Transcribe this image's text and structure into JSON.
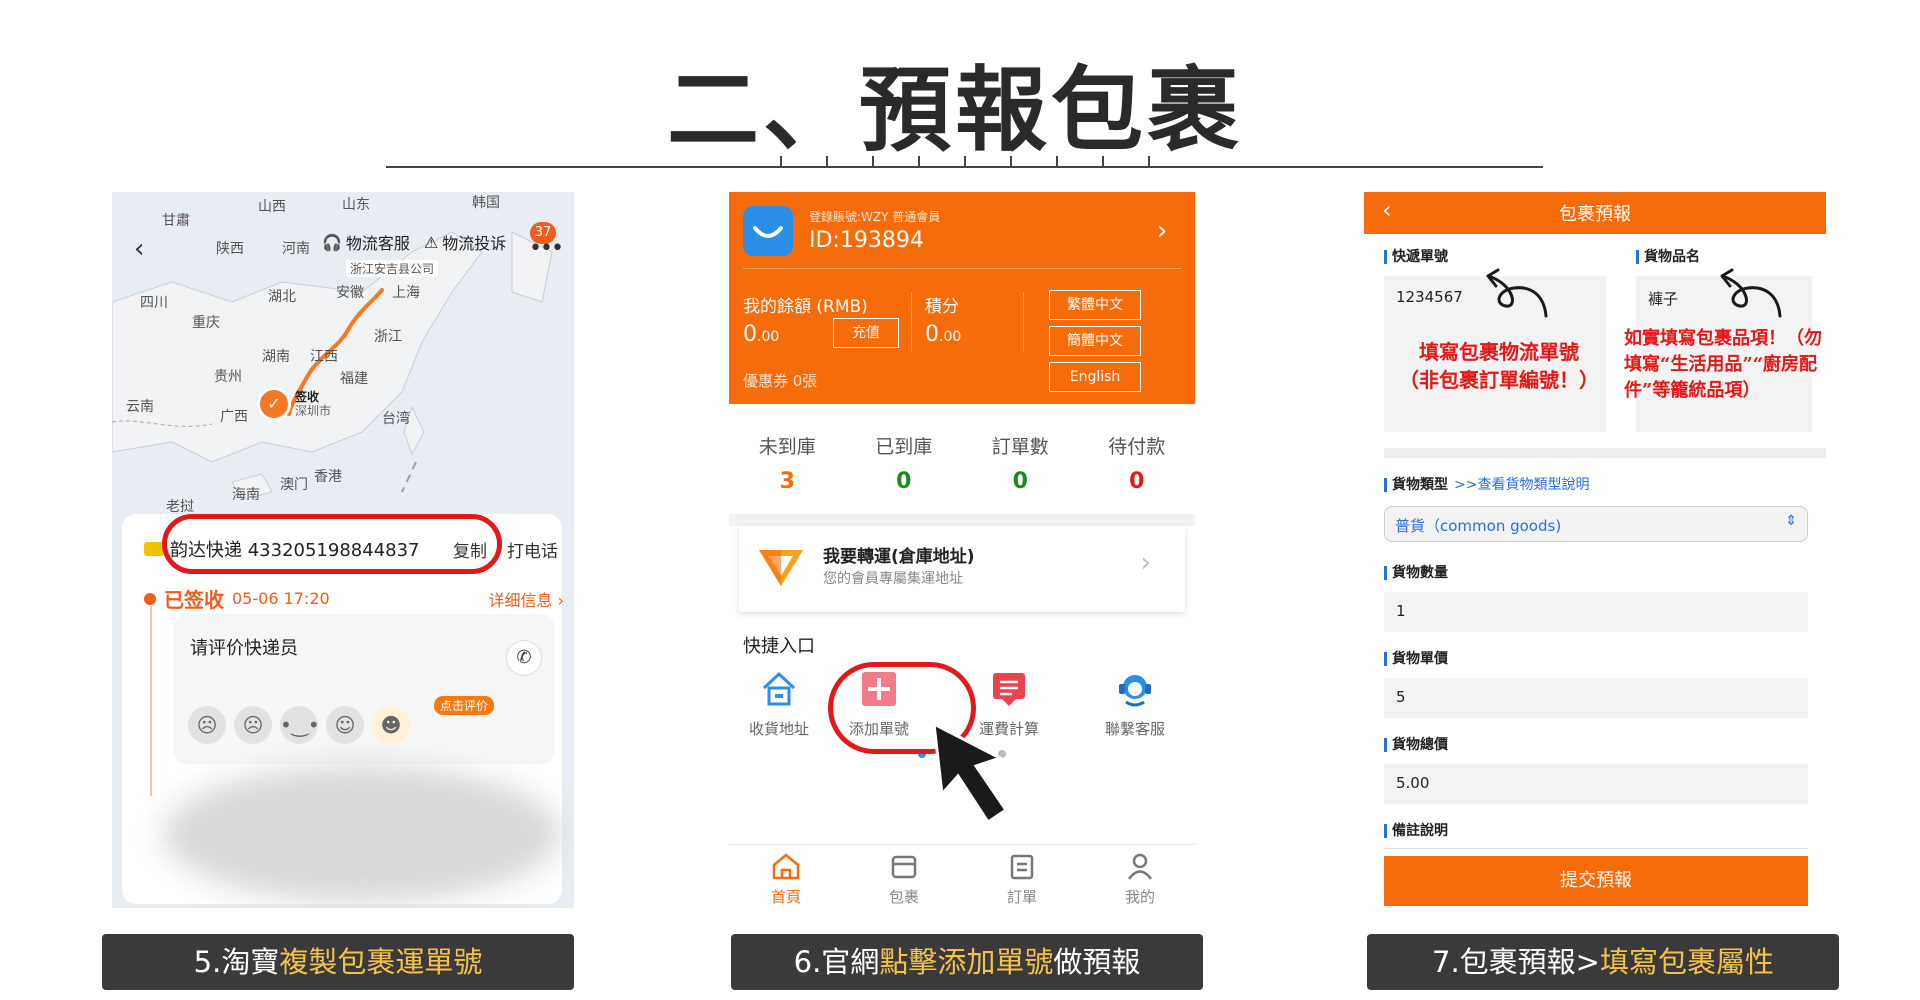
{
  "title": "二、預報包裹",
  "panel1": {
    "map_labels": [
      "甘肅",
      "山西",
      "山东",
      "韩国",
      "陕西",
      "河南",
      "四川",
      "湖北",
      "安徽",
      "上海",
      "重庆",
      "湖南",
      "江西",
      "浙江",
      "贵州",
      "福建",
      "云南",
      "广西",
      "台湾",
      "澳门",
      "香港",
      "海南",
      "老挝"
    ],
    "courier_header": "浙江安吉县公司",
    "service_label": "物流客服",
    "complaint_label": "物流投诉",
    "notification_count": "37",
    "sign_status": "签收",
    "sign_city": "深圳市",
    "tracking_text": "韵达快递 433205198844837",
    "copy_label": "复制",
    "call_label": "打电话",
    "status_label": "已签收",
    "status_time": "05-06 17:20",
    "details_link": "详细信息 ›",
    "rate_prompt": "请评价快递员",
    "rate_tag": "点击评价"
  },
  "panel2": {
    "account_label": "登錄賬號:WZY 普通會員",
    "member_id": "ID:193894",
    "balance_label": "我的餘額 (RMB)",
    "balance_value": "0",
    "balance_decimals": ".00",
    "recharge_label": "充值",
    "points_label": "積分",
    "points_value": "0",
    "points_decimals": ".00",
    "lang_options": [
      "繁體中文",
      "簡體中文",
      "English"
    ],
    "coupon_label": "優惠券 0張",
    "stats": [
      {
        "label": "未到庫",
        "value": "3",
        "color": "#f76c0a"
      },
      {
        "label": "已到庫",
        "value": "0",
        "color": "#1e8a1e"
      },
      {
        "label": "訂單數",
        "value": "0",
        "color": "#1e8a1e"
      },
      {
        "label": "待付款",
        "value": "0",
        "color": "#e31919"
      }
    ],
    "ship_title": "我要轉運(倉庫地址)",
    "ship_subtitle": "您的會員專屬集運地址",
    "quick_title": "快捷入口",
    "quick_items": [
      "收貨地址",
      "添加單號",
      "運費計算",
      "聯繫客服"
    ],
    "tabs": [
      "首頁",
      "包裹",
      "訂單",
      "我的"
    ],
    "active_color": "#f76c0a"
  },
  "panel3": {
    "header_title": "包裹預報",
    "tracking_label": "快遞單號",
    "tracking_value": "1234567",
    "tracking_note_line1": "填寫包裹物流單號",
    "tracking_note_line2": "（非包裹訂單編號！）",
    "goods_label": "貨物品名",
    "goods_value": "褲子",
    "goods_note": "如實填寫包裹品項！（勿填寫“生活用品”“廚房配件”等籠統品項）",
    "type_label": "貨物類型",
    "type_link": ">>查看貨物類型說明",
    "type_value": "普貨（common goods)",
    "qty_label": "貨物數量",
    "qty_value": "1",
    "price_label": "貨物單價",
    "price_value": "5",
    "total_label": "貨物總價",
    "total_value": "5.00",
    "remark_label": "備註說明",
    "submit_label": "提交預報"
  },
  "captions": [
    {
      "prefix": "5.淘寶",
      "highlight": "複製包裹運單號",
      "suffix": ""
    },
    {
      "prefix": "6.官網",
      "highlight": "點擊添加單號",
      "suffix": "做預報"
    },
    {
      "prefix": "7.包裹預報>",
      "highlight": "填寫包裹屬性",
      "suffix": ""
    }
  ]
}
